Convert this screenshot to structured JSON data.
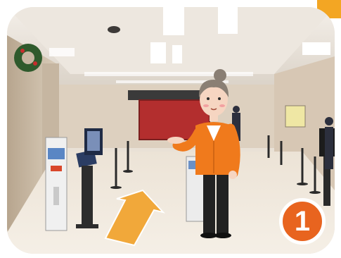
{
  "scene": {
    "step_badge": "1",
    "colors": {
      "badge": "#e8641f",
      "arrow": "#f1a83a",
      "staff_jacket": "#f07a1c",
      "corner_tab": "#f3a623"
    },
    "icons": [
      "up-arrow-icon",
      "number-badge-icon"
    ]
  }
}
